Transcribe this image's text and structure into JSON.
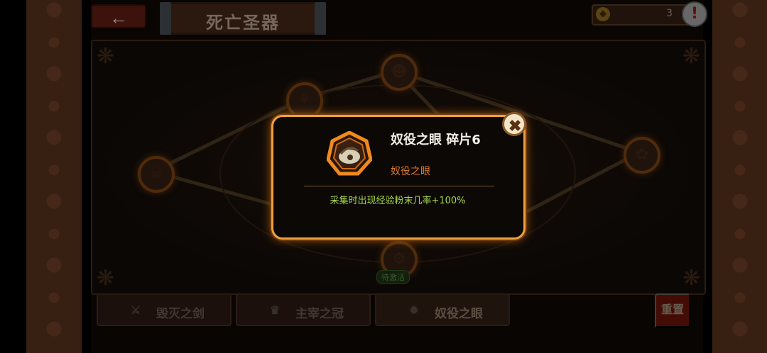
{
  "header": {
    "back_icon": "←",
    "title": "死亡圣器",
    "currency_value": "3",
    "alert_icon": "!"
  },
  "nodes": [
    {
      "name": "node-left",
      "icon": "☠"
    },
    {
      "name": "node-upper-left",
      "icon": "⚘"
    },
    {
      "name": "node-top",
      "icon": "☻"
    },
    {
      "name": "node-right",
      "icon": "✿"
    },
    {
      "name": "node-bottom",
      "icon": "⚙",
      "label": "待激活"
    }
  ],
  "tabs": [
    {
      "label": "毁灭之剑",
      "icon": "⚔"
    },
    {
      "label": "主宰之冠",
      "icon": "♛"
    },
    {
      "label": "奴役之眼",
      "icon": "✹"
    }
  ],
  "reset_label": "重置",
  "modal": {
    "title": "奴役之眼 碎片6",
    "subtitle": "奴役之眼",
    "effect": "采集时出现经验粉末几率+100%",
    "close_icon": "✖"
  },
  "colors": {
    "accent": "#f0a040",
    "effect_text": "#a6d84a",
    "subtitle_text": "#e07a28"
  }
}
